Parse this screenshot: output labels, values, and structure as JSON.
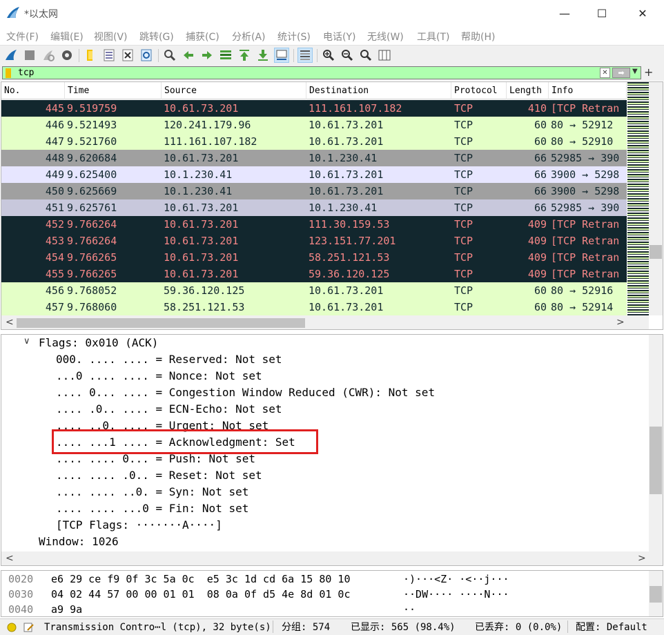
{
  "window": {
    "title": "*以太网",
    "minimize_glyph": "—",
    "maximize_glyph": "☐",
    "close_glyph": "✕"
  },
  "menu": [
    "文件(F)",
    "编辑(E)",
    "视图(V)",
    "跳转(G)",
    "捕获(C)",
    "分析(A)",
    "统计(S)",
    "电话(Y)",
    "无线(W)",
    "工具(T)",
    "帮助(H)"
  ],
  "toolbar": {
    "icons": [
      "shark-fin-start-icon",
      "stop-capture-icon",
      "restart-capture-icon",
      "capture-options-icon",
      "open-file-icon",
      "save-file-icon",
      "close-file-icon",
      "reload-file-icon",
      "find-packet-icon",
      "go-back-icon",
      "go-forward-icon",
      "go-to-packet-icon",
      "go-first-icon",
      "go-last-icon",
      "autoscroll-icon",
      "colorize-icon",
      "zoom-in-icon",
      "zoom-out-icon",
      "zoom-normal-icon",
      "resize-columns-icon"
    ]
  },
  "filter": {
    "value": "tcp",
    "clear_glyph": "✕",
    "apply_glyph": "➡",
    "dropdown_glyph": "▼",
    "add_glyph": "+"
  },
  "packet_list": {
    "columns": [
      "No.",
      "Time",
      "Source",
      "Destination",
      "Protocol",
      "Length",
      "Info"
    ],
    "rows": [
      {
        "no": "445",
        "time": "9.519759",
        "src": "10.61.73.201",
        "dst": "111.161.107.182",
        "proto": "TCP",
        "len": "410",
        "info": "[TCP Retran"
      },
      {
        "no": "446",
        "time": "9.521493",
        "src": "120.241.179.96",
        "dst": "10.61.73.201",
        "proto": "TCP",
        "len": "60",
        "info": "80 → 52912"
      },
      {
        "no": "447",
        "time": "9.521760",
        "src": "111.161.107.182",
        "dst": "10.61.73.201",
        "proto": "TCP",
        "len": "60",
        "info": "80 → 52910"
      },
      {
        "no": "448",
        "time": "9.620684",
        "src": "10.61.73.201",
        "dst": "10.1.230.41",
        "proto": "TCP",
        "len": "66",
        "info": "52985 → 390"
      },
      {
        "no": "449",
        "time": "9.625400",
        "src": "10.1.230.41",
        "dst": "10.61.73.201",
        "proto": "TCP",
        "len": "66",
        "info": "3900 → 5298"
      },
      {
        "no": "450",
        "time": "9.625669",
        "src": "10.1.230.41",
        "dst": "10.61.73.201",
        "proto": "TCP",
        "len": "66",
        "info": "3900 → 5298"
      },
      {
        "no": "451",
        "time": "9.625761",
        "src": "10.61.73.201",
        "dst": "10.1.230.41",
        "proto": "TCP",
        "len": "66",
        "info": "52985 → 390"
      },
      {
        "no": "452",
        "time": "9.766264",
        "src": "10.61.73.201",
        "dst": "111.30.159.53",
        "proto": "TCP",
        "len": "409",
        "info": "[TCP Retran"
      },
      {
        "no": "453",
        "time": "9.766264",
        "src": "10.61.73.201",
        "dst": "123.151.77.201",
        "proto": "TCP",
        "len": "409",
        "info": "[TCP Retran"
      },
      {
        "no": "454",
        "time": "9.766265",
        "src": "10.61.73.201",
        "dst": "58.251.121.53",
        "proto": "TCP",
        "len": "409",
        "info": "[TCP Retran"
      },
      {
        "no": "455",
        "time": "9.766265",
        "src": "10.61.73.201",
        "dst": "59.36.120.125",
        "proto": "TCP",
        "len": "409",
        "info": "[TCP Retran"
      },
      {
        "no": "456",
        "time": "9.768052",
        "src": "59.36.120.125",
        "dst": "10.61.73.201",
        "proto": "TCP",
        "len": "60",
        "info": "80 → 52916"
      },
      {
        "no": "457",
        "time": "9.768060",
        "src": "58.251.121.53",
        "dst": "10.61.73.201",
        "proto": "TCP",
        "len": "60",
        "info": "80 → 52914"
      }
    ],
    "row_styles": {
      "retrans": {
        "bg": "#12272e",
        "fg": "#f78787"
      },
      "green": {
        "bg": "#e4ffc7",
        "fg": "#12272e"
      },
      "gray": {
        "bg": "#a0a0a0",
        "fg": "#12272e"
      },
      "lavender": {
        "bg": "#e7e6ff",
        "fg": "#12272e"
      },
      "selected_lavender": {
        "bg": "#c8c8dc",
        "fg": "#12272e"
      }
    },
    "row_style_keys": [
      "retrans",
      "green",
      "green",
      "gray",
      "lavender",
      "gray",
      "selected_lavender",
      "retrans",
      "retrans",
      "retrans",
      "retrans",
      "green",
      "green"
    ],
    "scroll_left": "<",
    "scroll_right": ">"
  },
  "details": {
    "expander": "∨",
    "lines": [
      "Flags: 0x010 (ACK)",
      "000. .... .... = Reserved: Not set",
      "...0 .... .... = Nonce: Not set",
      ".... 0... .... = Congestion Window Reduced (CWR): Not set",
      ".... .0.. .... = ECN-Echo: Not set",
      ".... ..0. .... = Urgent: Not set",
      ".... ...1 .... = Acknowledgment: Set",
      ".... .... 0... = Push: Not set",
      ".... .... .0.. = Reset: Not set",
      ".... .... ..0. = Syn: Not set",
      ".... .... ...0 = Fin: Not set",
      "[TCP Flags: ·······A····]",
      "Window: 1026"
    ],
    "scroll_left": "<",
    "scroll_right": ">"
  },
  "hex": {
    "rows": [
      {
        "offset": "0020",
        "bytes": "e6 29 ce f9 0f 3c 5a 0c  e5 3c 1d cd 6a 15 80 10",
        "ascii": "·)···<Z· ·<··j···"
      },
      {
        "offset": "0030",
        "bytes": "04 02 44 57 00 00 01 01  08 0a 0f d5 4e 8d 01 0c",
        "ascii": "··DW···· ····N···"
      },
      {
        "offset": "0040",
        "bytes": "a9 9a",
        "ascii": "··"
      }
    ]
  },
  "status": {
    "summary": "Transmission Contro⋯l (tcp), 32 byte(s)",
    "packets": "分组: 574",
    "displayed": "已显示: 565 (98.4%)",
    "dropped": "已丢弃: 0 (0.0%)",
    "profile": "配置: Default"
  }
}
